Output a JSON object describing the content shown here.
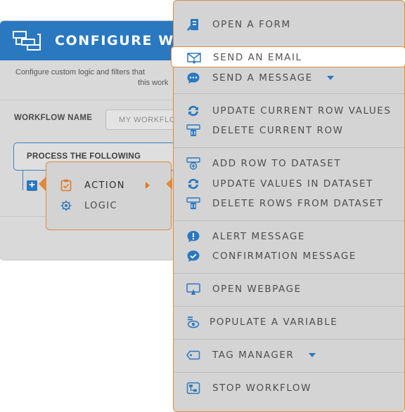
{
  "dialog": {
    "title": "CONFIGURE WO",
    "description_line1": "Configure custom logic and filters that",
    "description_line2": "this work",
    "workflow_name_label": "WORKFLOW NAME",
    "workflow_name_placeholder": "MY WORKFLO",
    "process_label": "PROCESS THE FOLLOWING",
    "add_label": "+"
  },
  "popup": {
    "items": [
      {
        "label": "ACTION",
        "icon": "clipboard-check-icon"
      },
      {
        "label": "LOGIC",
        "icon": "gear-bulb-icon"
      }
    ]
  },
  "menu": {
    "items": [
      {
        "label": "OPEN A FORM",
        "icon": "form-icon"
      },
      {
        "label": "SEND AN EMAIL",
        "icon": "email-icon"
      },
      {
        "label": "SEND A MESSAGE",
        "icon": "chat-icon"
      },
      {
        "label": "UPDATE CURRENT ROW VALUES",
        "icon": "sync-icon"
      },
      {
        "label": "DELETE CURRENT ROW",
        "icon": "delete-row-icon"
      },
      {
        "label": "ADD ROW TO DATASET",
        "icon": "add-row-icon"
      },
      {
        "label": "UPDATE VALUES IN DATASET",
        "icon": "sync-icon"
      },
      {
        "label": "DELETE ROWS FROM DATASET",
        "icon": "delete-rows-icon"
      },
      {
        "label": "ALERT MESSAGE",
        "icon": "alert-icon"
      },
      {
        "label": "CONFIRMATION MESSAGE",
        "icon": "confirm-icon"
      },
      {
        "label": "OPEN WEBPAGE",
        "icon": "monitor-icon"
      },
      {
        "label": "POPULATE A VARIABLE",
        "icon": "variable-icon"
      },
      {
        "label": "TAG MANAGER",
        "icon": "tag-icon"
      },
      {
        "label": "STOP WORKFLOW",
        "icon": "stop-workflow-icon"
      }
    ]
  },
  "colors": {
    "accent_orange": "#e08a3c",
    "brand_blue": "#2a78c0",
    "menu_bg": "#d4d4d4",
    "label_gray": "#4e4e4e"
  }
}
